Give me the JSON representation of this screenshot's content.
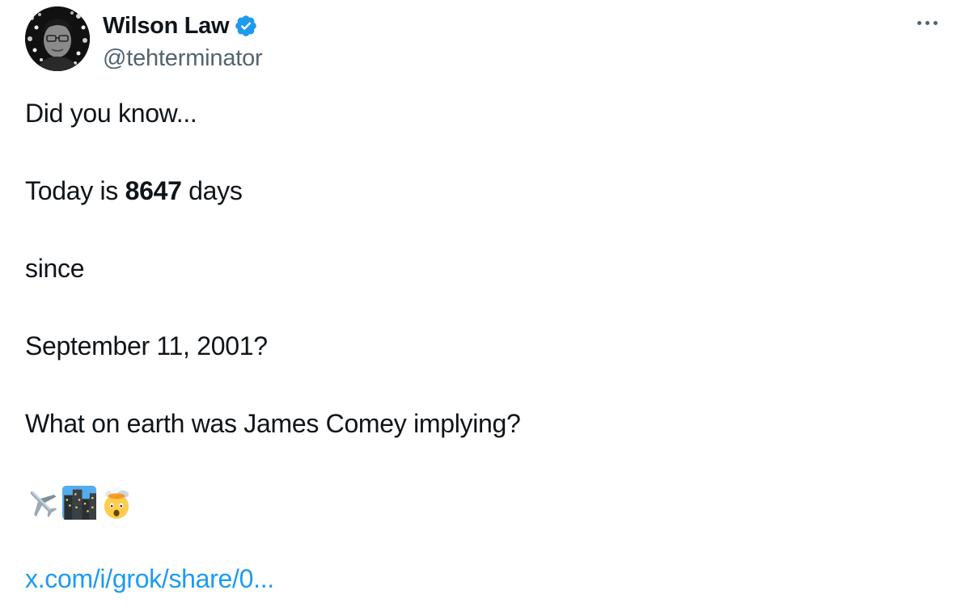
{
  "author": {
    "display_name": "Wilson Law",
    "handle": "@tehterminator",
    "verified": true,
    "verified_color": "#1d9bf0"
  },
  "more_menu_icon": "ellipsis-icon",
  "tweet": {
    "line1": "Did you know...",
    "line2_prefix": "Today is ",
    "line2_bold": "8647",
    "line2_suffix": " days",
    "line3": "since",
    "line4": "September 11, 2001?",
    "line5": "What on earth was James Comey implying?",
    "emojis": [
      "airplane-emoji",
      "night-city-emoji",
      "exploding-head-emoji"
    ],
    "link_text": "x.com/i/grok/share/0..."
  },
  "colors": {
    "text_primary": "#0f1419",
    "text_secondary": "#536471",
    "link": "#1d9bf0"
  }
}
